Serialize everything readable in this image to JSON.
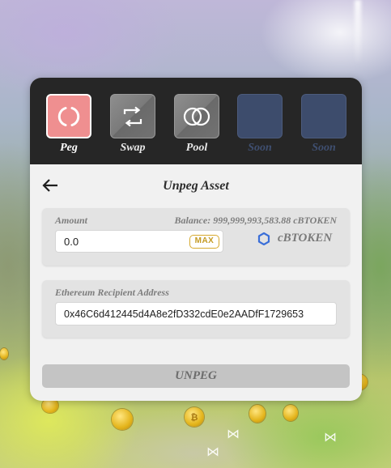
{
  "nav": {
    "tabs": [
      {
        "label": "Peg",
        "icon": "peg-ring-icon",
        "active": true
      },
      {
        "label": "Swap",
        "icon": "swap-arrows-icon",
        "active": false
      },
      {
        "label": "Pool",
        "icon": "pool-circles-icon",
        "active": false
      },
      {
        "label": "Soon",
        "icon": "",
        "active": false
      },
      {
        "label": "Soon",
        "icon": "",
        "active": false
      }
    ]
  },
  "panel": {
    "title": "Unpeg Asset",
    "back_icon": "arrow-left-icon"
  },
  "amount": {
    "label": "Amount",
    "balance": "Balance: 999,999,993,583.88 cBTOKEN",
    "value": "0.0",
    "max_label": "MAX",
    "token_name": "cBTOKEN",
    "token_icon": "token-hexagon-icon"
  },
  "recipient": {
    "label": "Ethereum Recipient Address",
    "value": "0x46C6d412445d4A8e2fD332cdE0e2AADfF1729653"
  },
  "submit": {
    "label": "UNPEG"
  },
  "colors": {
    "peg_active": "#ef8f90",
    "tab_bar": "#262626",
    "soon_tile": "#3d4c6c",
    "max_gold": "#d6a92e",
    "token_blue": "#3b6fd8"
  }
}
